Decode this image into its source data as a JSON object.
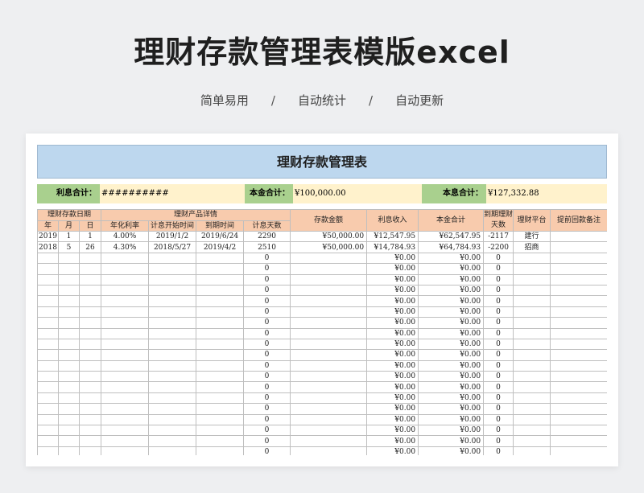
{
  "page": {
    "main_title": "理财存款管理表模版excel",
    "subtitle_items": [
      "简单易用",
      "自动统计",
      "自动更新"
    ],
    "subtitle_sep": "/"
  },
  "sheet": {
    "title": "理财存款管理表",
    "summary": {
      "interest_label": "利息合计：",
      "interest_value": "##########",
      "principal_label": "本金合计：",
      "principal_value": "¥100,000.00",
      "total_label": "本息合计：",
      "total_value": "¥127,332.88"
    },
    "headers": {
      "group_date": "理财存款日期",
      "group_product": "理财产品详情",
      "year": "年",
      "month": "月",
      "day": "日",
      "rate": "年化利率",
      "start": "计息开始时间",
      "end": "到期时间",
      "days": "计息天数",
      "deposit": "存款金额",
      "interest": "利息收入",
      "total": "本金合计",
      "remaining": "到期理财天数",
      "platform": "理财平台",
      "note": "提前回款备注"
    },
    "rows": [
      [
        "2019",
        "1",
        "1",
        "4.00%",
        "2019/1/2",
        "2019/6/24",
        "2290",
        "¥50,000.00",
        "¥12,547.95",
        "¥62,547.95",
        "-2117",
        "建行",
        ""
      ],
      [
        "2018",
        "5",
        "26",
        "4.30%",
        "2018/5/27",
        "2019/4/2",
        "2510",
        "¥50,000.00",
        "¥14,784.93",
        "¥64,784.93",
        "-2200",
        "招商",
        ""
      ],
      [
        "",
        "",
        "",
        "",
        "",
        "",
        "0",
        "",
        "¥0.00",
        "¥0.00",
        "0",
        "",
        ""
      ],
      [
        "",
        "",
        "",
        "",
        "",
        "",
        "0",
        "",
        "¥0.00",
        "¥0.00",
        "0",
        "",
        ""
      ],
      [
        "",
        "",
        "",
        "",
        "",
        "",
        "0",
        "",
        "¥0.00",
        "¥0.00",
        "0",
        "",
        ""
      ],
      [
        "",
        "",
        "",
        "",
        "",
        "",
        "0",
        "",
        "¥0.00",
        "¥0.00",
        "0",
        "",
        ""
      ],
      [
        "",
        "",
        "",
        "",
        "",
        "",
        "0",
        "",
        "¥0.00",
        "¥0.00",
        "0",
        "",
        ""
      ],
      [
        "",
        "",
        "",
        "",
        "",
        "",
        "0",
        "",
        "¥0.00",
        "¥0.00",
        "0",
        "",
        ""
      ],
      [
        "",
        "",
        "",
        "",
        "",
        "",
        "0",
        "",
        "¥0.00",
        "¥0.00",
        "0",
        "",
        ""
      ],
      [
        "",
        "",
        "",
        "",
        "",
        "",
        "0",
        "",
        "¥0.00",
        "¥0.00",
        "0",
        "",
        ""
      ],
      [
        "",
        "",
        "",
        "",
        "",
        "",
        "0",
        "",
        "¥0.00",
        "¥0.00",
        "0",
        "",
        ""
      ],
      [
        "",
        "",
        "",
        "",
        "",
        "",
        "0",
        "",
        "¥0.00",
        "¥0.00",
        "0",
        "",
        ""
      ],
      [
        "",
        "",
        "",
        "",
        "",
        "",
        "0",
        "",
        "¥0.00",
        "¥0.00",
        "0",
        "",
        ""
      ],
      [
        "",
        "",
        "",
        "",
        "",
        "",
        "0",
        "",
        "¥0.00",
        "¥0.00",
        "0",
        "",
        ""
      ],
      [
        "",
        "",
        "",
        "",
        "",
        "",
        "0",
        "",
        "¥0.00",
        "¥0.00",
        "0",
        "",
        ""
      ],
      [
        "",
        "",
        "",
        "",
        "",
        "",
        "0",
        "",
        "¥0.00",
        "¥0.00",
        "0",
        "",
        ""
      ],
      [
        "",
        "",
        "",
        "",
        "",
        "",
        "0",
        "",
        "¥0.00",
        "¥0.00",
        "0",
        "",
        ""
      ],
      [
        "",
        "",
        "",
        "",
        "",
        "",
        "0",
        "",
        "¥0.00",
        "¥0.00",
        "0",
        "",
        ""
      ],
      [
        "",
        "",
        "",
        "",
        "",
        "",
        "0",
        "",
        "¥0.00",
        "¥0.00",
        "0",
        "",
        ""
      ],
      [
        "",
        "",
        "",
        "",
        "",
        "",
        "0",
        "",
        "¥0.00",
        "¥0.00",
        "0",
        "",
        ""
      ],
      [
        "",
        "",
        "",
        "",
        "",
        "",
        "0",
        "",
        "¥0.00",
        "¥0.00",
        "0",
        "",
        ""
      ]
    ]
  },
  "colors": {
    "title_band": "#bdd7ee",
    "label_green": "#a9d08e",
    "value_yellow": "#fff2cc",
    "header_peach": "#f8cbad"
  }
}
